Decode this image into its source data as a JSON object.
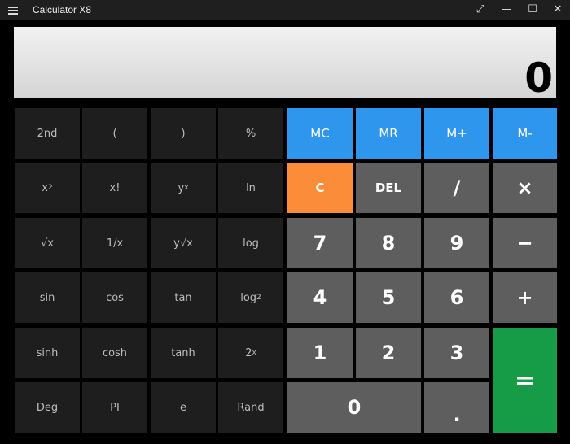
{
  "window": {
    "title": "Calculator X8",
    "fullscreen_glyph": "⤢",
    "minimize_glyph": "—",
    "maximize_glyph": "☐",
    "close_glyph": "✕"
  },
  "display": {
    "value": "0"
  },
  "scientific": {
    "second": "2nd",
    "lparen": "(",
    "rparen": ")",
    "percent": "%",
    "x_base": "x",
    "square_sup": "2",
    "factorial": "x!",
    "y_base": "y",
    "power_sup": "x",
    "ln": "ln",
    "sqrt": "√x",
    "reciprocal": "1/x",
    "yroot": "y√x",
    "log": "log",
    "sin": "sin",
    "cos": "cos",
    "tan": "tan",
    "log_base": "log",
    "log2_sub": "2",
    "sinh": "sinh",
    "cosh": "cosh",
    "tanh": "tanh",
    "two_base": "2",
    "two_pow_sup": "x",
    "deg": "Deg",
    "pi": "PI",
    "e": "e",
    "rand": "Rand"
  },
  "memory": {
    "mc": "MC",
    "mr": "MR",
    "mplus": "M+",
    "mminus": "M-"
  },
  "keypad": {
    "clear": "C",
    "del": "DEL",
    "divide": "/",
    "multiply": "×",
    "seven": "7",
    "eight": "8",
    "nine": "9",
    "minus": "−",
    "four": "4",
    "five": "5",
    "six": "6",
    "plus": "+",
    "one": "1",
    "two": "2",
    "three": "3",
    "equals": "=",
    "zero": "0",
    "dot": "."
  },
  "colors": {
    "memory": "#2f96ee",
    "clear": "#fb8c3a",
    "equals": "#169c47",
    "keypad": "#5e5e5e",
    "scientific": "#1e1e1e"
  }
}
